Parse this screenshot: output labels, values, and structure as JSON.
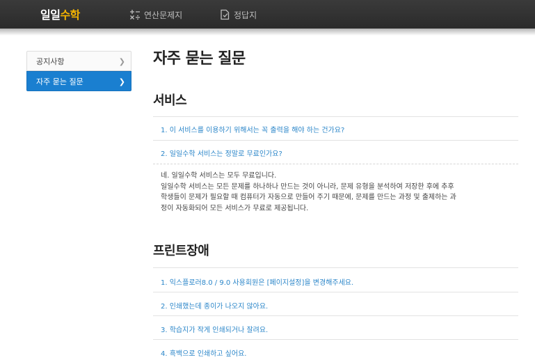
{
  "header": {
    "logo": {
      "part1": "일일",
      "part2": "수학"
    },
    "nav": [
      {
        "label": "연산문제지",
        "icon": "plus-minus-times-divide-icon"
      },
      {
        "label": "정답지",
        "icon": "document-check-icon"
      }
    ]
  },
  "sidebar": {
    "items": [
      {
        "label": "공지사항",
        "active": false
      },
      {
        "label": "자주 묻는 질문",
        "active": true
      }
    ]
  },
  "main": {
    "title": "자주 묻는 질문",
    "sections": [
      {
        "title": "서비스",
        "questions": [
          "1. 이 서비스를 이용하기 위해서는 꼭 출력을 해야 하는 건가요?",
          "2. 일일수학 서비스는 정말로 무료인가요?"
        ],
        "answer_lines": [
          "네. 일일수학 서비스는 모두 무료입니다.",
          "일일수학 서비스는 모든 문제를 하나하나 만드는 것이 아니라, 문제 유형을 분석하여 저장한 후에 추후",
          "학생들이 문제가 필요할 때 컴퓨터가 자동으로 만들어 주기 때문에, 문제를 만드는 과정 및 출제하는 과",
          "정이 자동화되어 모든 서비스가 무료로 제공됩니다."
        ]
      },
      {
        "title": "프린트장애",
        "questions": [
          "1. 익스플로러8.0 / 9.0 사용회원은 [페이지설정]을 변경해주세요.",
          "2. 인쇄했는데 종이가 나오지 않아요.",
          "3. 학습지가 작게 인쇄되거나 잘려요.",
          "4. 흑백으로 인쇄하고 싶어요."
        ]
      }
    ]
  },
  "colors": {
    "header_bg": "#2b2b2b",
    "logo_accent": "#f5b400",
    "sidebar_active": "#1a7fd0",
    "link": "#2b86c9"
  }
}
